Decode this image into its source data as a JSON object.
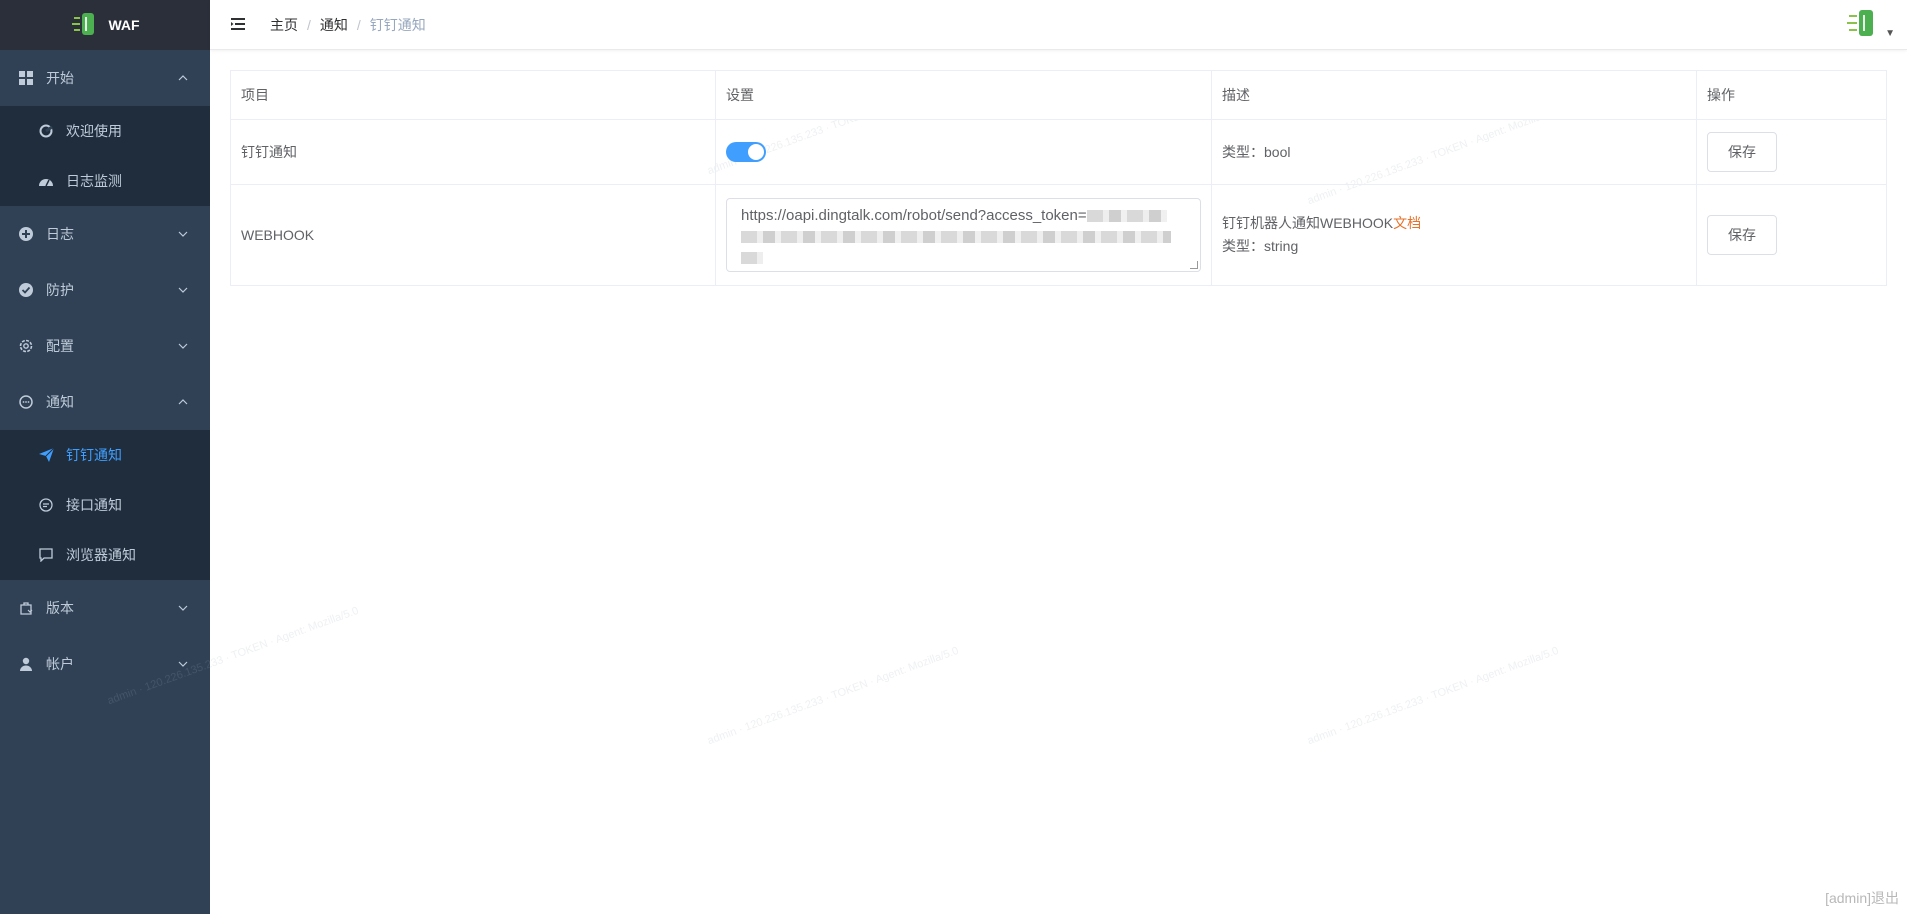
{
  "app": {
    "logo_text": "WAF"
  },
  "sidebar": {
    "items": [
      {
        "label": "开始",
        "icon": "grid-icon",
        "expanded": true,
        "children": [
          {
            "label": "欢迎使用",
            "icon": "refresh-icon"
          },
          {
            "label": "日志监测",
            "icon": "dashboard-icon"
          }
        ]
      },
      {
        "label": "日志",
        "icon": "plus-circle-icon",
        "expanded": false
      },
      {
        "label": "防护",
        "icon": "check-circle-icon",
        "expanded": false
      },
      {
        "label": "配置",
        "icon": "gear-icon",
        "expanded": false
      },
      {
        "label": "通知",
        "icon": "chat-icon",
        "expanded": true,
        "children": [
          {
            "label": "钉钉通知",
            "icon": "send-icon",
            "active": true
          },
          {
            "label": "接口通知",
            "icon": "chat-dots-icon"
          },
          {
            "label": "浏览器通知",
            "icon": "message-icon"
          }
        ]
      },
      {
        "label": "版本",
        "icon": "bag-icon",
        "expanded": false
      },
      {
        "label": "帐户",
        "icon": "user-icon",
        "expanded": false
      }
    ]
  },
  "header": {
    "breadcrumb": [
      "主页",
      "通知",
      "钉钉通知"
    ],
    "separator": "/"
  },
  "table": {
    "headers": [
      "项目",
      "设置",
      "描述",
      "操作"
    ],
    "rows": [
      {
        "item": "钉钉通知",
        "setting_type": "switch",
        "switch_on": true,
        "desc_prefix": "",
        "desc_link": "",
        "desc_type": "类型：bool",
        "action": "保存"
      },
      {
        "item": "WEBHOOK",
        "setting_type": "textarea",
        "value": "https://oapi.dingtalk.com/robot/send?access_token=",
        "desc_prefix": "钉钉机器人通知WEBHOOK",
        "desc_link": "文档",
        "desc_type": "类型：string",
        "action": "保存"
      }
    ]
  },
  "footer": {
    "text": "[admin]退出"
  },
  "colors": {
    "sidebar_bg": "#304156",
    "submenu_bg": "#1f2d3d",
    "active": "#409eff",
    "link": "#e6722b"
  }
}
